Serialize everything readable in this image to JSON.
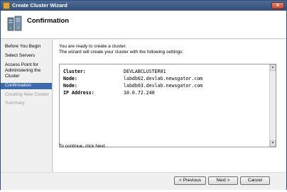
{
  "window": {
    "title": "Create Cluster Wizard",
    "close_glyph": "x"
  },
  "header": {
    "title": "Confirmation"
  },
  "sidebar": {
    "items": [
      {
        "label": "Before You Begin",
        "state": "normal"
      },
      {
        "label": "Select Servers",
        "state": "normal"
      },
      {
        "label": "Access Point for Administering the Cluster",
        "state": "normal"
      },
      {
        "label": "Confirmation",
        "state": "current"
      },
      {
        "label": "Creating New Cluster",
        "state": "disabled"
      },
      {
        "label": "Summary",
        "state": "disabled"
      }
    ]
  },
  "content": {
    "intro_line1": "You are ready to create a cluster.",
    "intro_line2": "The wizard will create your cluster with the following settings:",
    "settings": [
      {
        "key": "Cluster:",
        "value": "DEVLABCLUSTER01"
      },
      {
        "key": "Node:",
        "value": "labdb02.devlab.newsgator.com"
      },
      {
        "key": "Node:",
        "value": "labdb03.devlab.newsgator.com"
      },
      {
        "key": "IP Address:",
        "value": "10.0.72.240"
      }
    ],
    "footer": "To continue, click Next."
  },
  "buttons": {
    "previous": "< Previous",
    "next": "Next >",
    "cancel": "Cancel"
  },
  "colors": {
    "titlebar": "#33507c",
    "current_step": "#3d6aab",
    "disabled_text": "#9a9a9a"
  }
}
